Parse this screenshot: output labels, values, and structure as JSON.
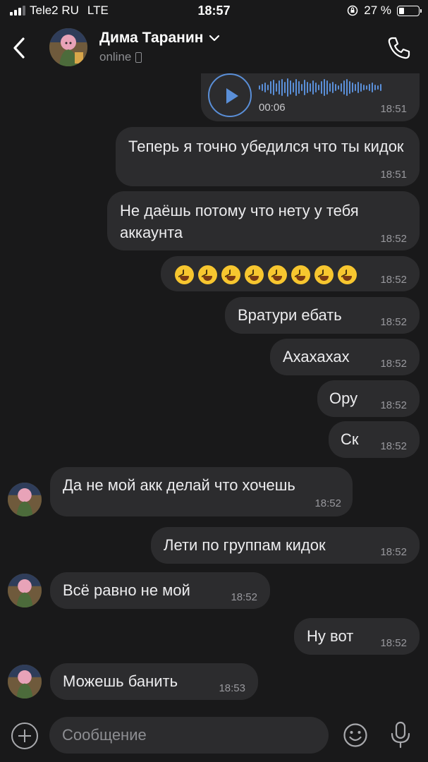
{
  "status": {
    "carrier": "Tele2 RU",
    "network": "LTE",
    "time": "18:57",
    "battery": "27 %",
    "battery_level": 0.27
  },
  "header": {
    "name": "Дима Таранин",
    "presence": "online"
  },
  "voice": {
    "duration": "00:06",
    "time": "18:51"
  },
  "messages": [
    {
      "side": "out",
      "text": "Теперь я точно убедился что ты кидок",
      "time": "18:51"
    },
    {
      "side": "out",
      "text": "Не даёшь потому что нету у тебя аккаунта",
      "time": "18:52"
    },
    {
      "side": "out",
      "emoji": "😆😆😆😆😆😆😆😆",
      "emoji_count": 8,
      "time": "18:52"
    },
    {
      "side": "out",
      "text": "Вратури ебать",
      "time": "18:52"
    },
    {
      "side": "out",
      "text": "Ахахахах",
      "time": "18:52"
    },
    {
      "side": "out",
      "text": "Ору",
      "time": "18:52"
    },
    {
      "side": "out",
      "text": "Ск",
      "time": "18:52"
    },
    {
      "side": "in",
      "text": "Да не мой акк делай что хочешь",
      "time": "18:52"
    },
    {
      "side": "out",
      "text": "Лети по группам кидок",
      "time": "18:52"
    },
    {
      "side": "in",
      "text": "Всё равно не мой",
      "time": "18:52"
    },
    {
      "side": "out",
      "text": "Ну вот",
      "time": "18:52"
    },
    {
      "side": "in",
      "text": "Можешь банить",
      "time": "18:53"
    }
  ],
  "input": {
    "placeholder": "Сообщение"
  },
  "colors": {
    "background": "#19191a",
    "bubble": "#2c2c2e",
    "accent": "#5a8fd8",
    "meta": "#98989d"
  },
  "icons": [
    "back-arrow-icon",
    "chevron-down-icon",
    "mobile-device-icon",
    "phone-call-icon",
    "play-icon",
    "plus-icon",
    "emoji-smile-icon",
    "microphone-icon"
  ]
}
